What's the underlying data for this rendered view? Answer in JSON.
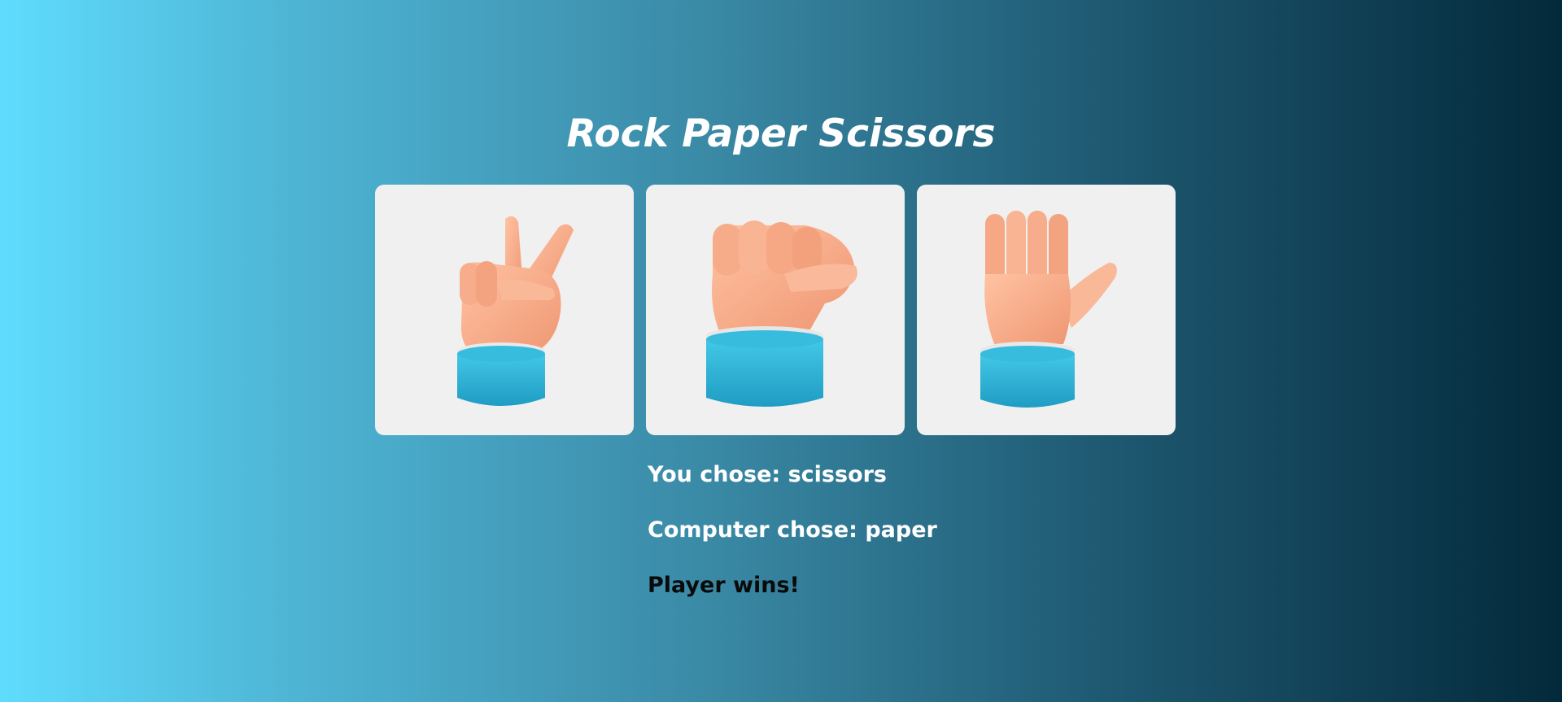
{
  "game": {
    "title": "Rock Paper Scissors"
  },
  "choices": [
    {
      "id": "scissors",
      "icon": "hand-peace-sign-icon"
    },
    {
      "id": "rock",
      "icon": "hand-fist-icon"
    },
    {
      "id": "paper",
      "icon": "hand-open-palm-icon"
    }
  ],
  "result": {
    "player_choice_text": "You chose: scissors",
    "computer_choice_text": "Computer chose: paper",
    "outcome_text": "Player wins!"
  },
  "colors": {
    "gradient_start": "#5fdcfd",
    "gradient_end": "#032a3a",
    "card_bg": "#f0f0f0",
    "skin": "#f6a887",
    "cuff": "#2db6d6",
    "text_light": "#ffffff",
    "text_dark": "#0a0a0a"
  }
}
